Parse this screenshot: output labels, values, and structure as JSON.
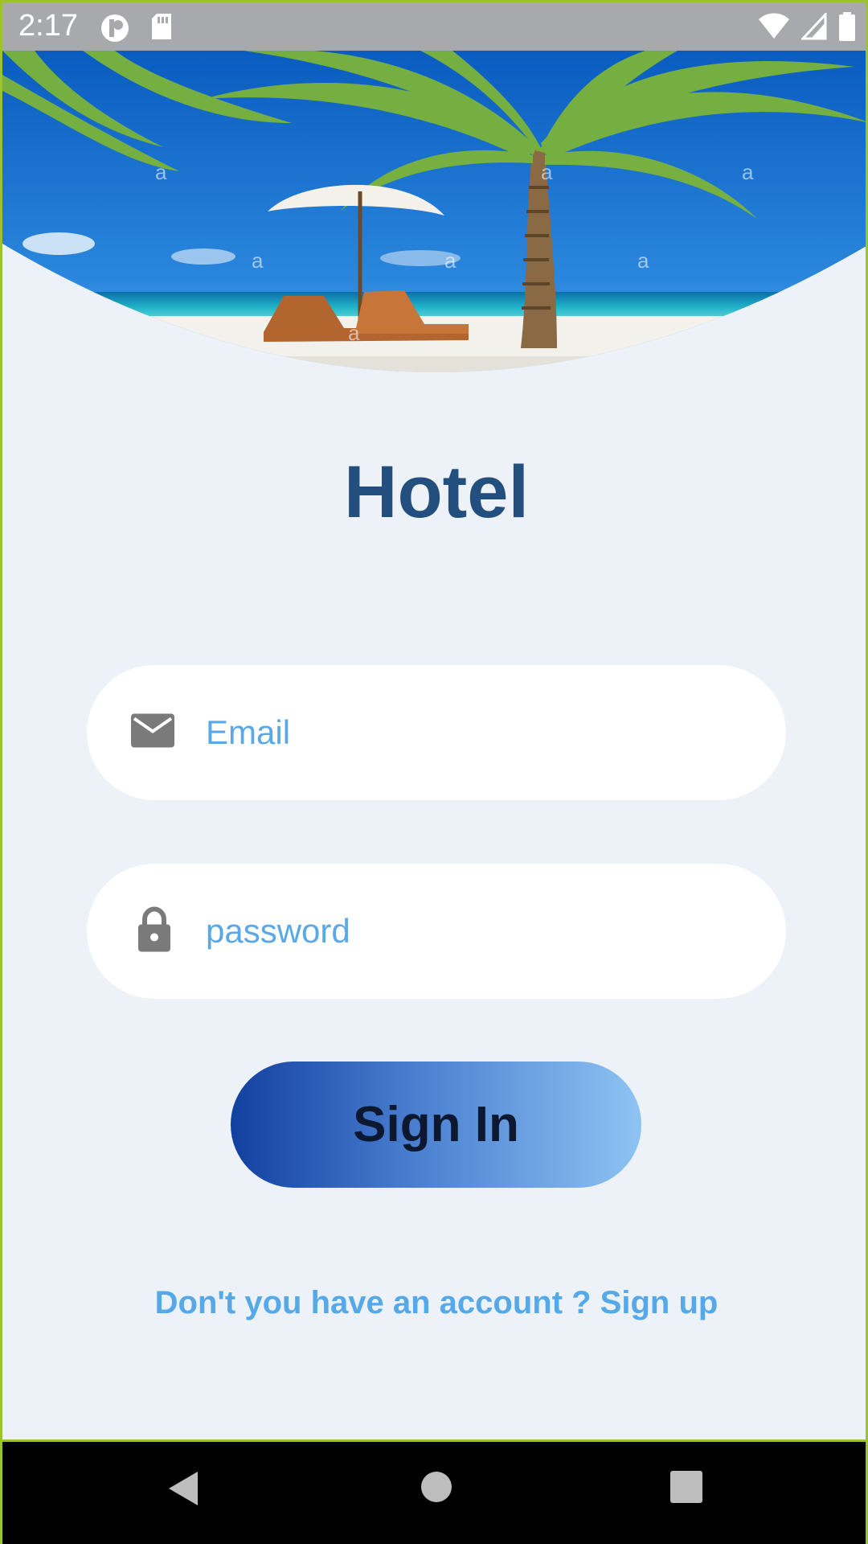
{
  "status_bar": {
    "time": "2:17",
    "icons": [
      "app-notification-icon",
      "sd-card-icon",
      "wifi-icon",
      "signal-icon",
      "battery-icon"
    ]
  },
  "hero": {
    "description_icon": "beach-palm-image"
  },
  "title": "Hotel",
  "email_field": {
    "placeholder": "Email",
    "icon": "mail-icon"
  },
  "password_field": {
    "placeholder": "password",
    "icon": "lock-icon"
  },
  "signin_button": {
    "label": "Sign In"
  },
  "signup_link": {
    "label": "Don't you have an account ? Sign up"
  },
  "nav_bar": {
    "icons": [
      "back-icon",
      "home-icon",
      "recents-icon"
    ]
  },
  "colors": {
    "background": "#edf2f8",
    "title": "#234f7e",
    "placeholder": "#5aa8e8",
    "link": "#56a9e8",
    "button_gradient_start": "#1240a0",
    "button_gradient_end": "#8ec3f3"
  }
}
